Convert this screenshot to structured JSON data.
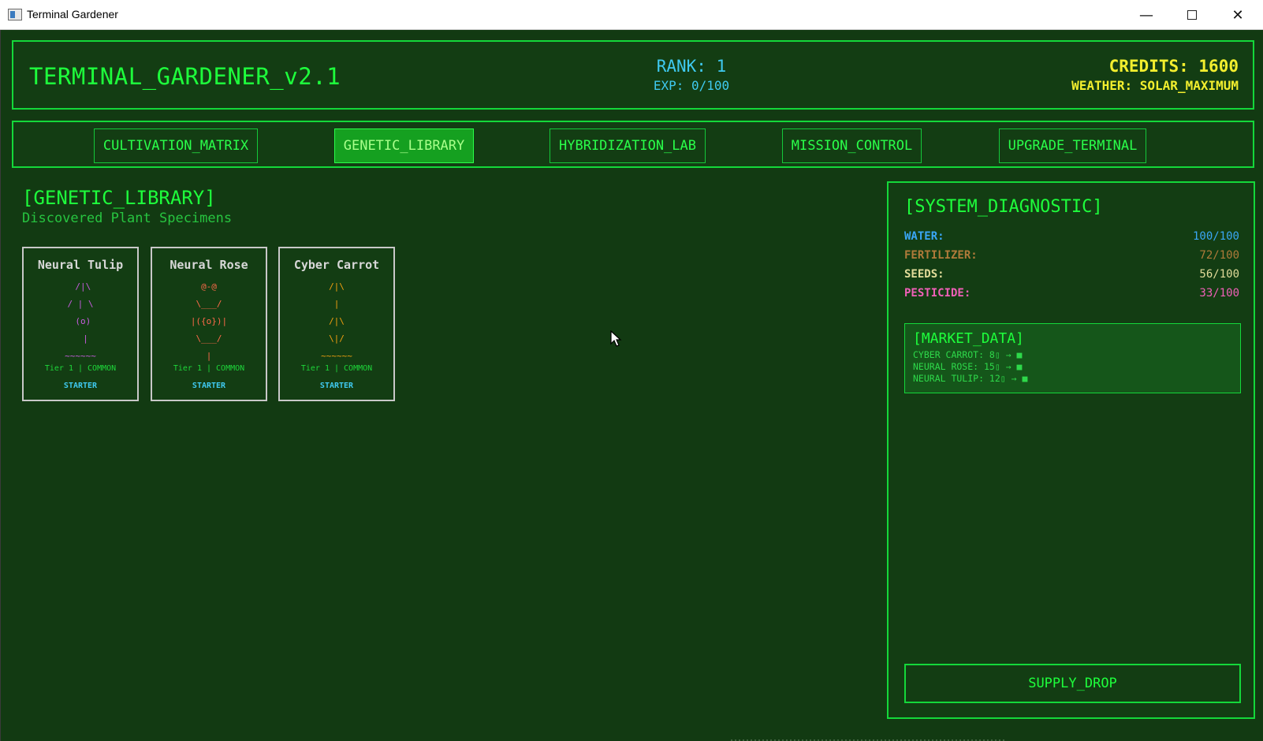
{
  "window": {
    "title": "Terminal Gardener"
  },
  "header": {
    "app_name": "TERMINAL_GARDENER_v2.1",
    "rank": "RANK: 1",
    "exp": "EXP: 0/100",
    "credits": "CREDITS: 1600",
    "weather": "WEATHER: SOLAR_MAXIMUM"
  },
  "nav": {
    "tabs": [
      {
        "label": "CULTIVATION_MATRIX",
        "active": false
      },
      {
        "label": "GENETIC_LIBRARY",
        "active": true
      },
      {
        "label": "HYBRIDIZATION_LAB",
        "active": false
      },
      {
        "label": "MISSION_CONTROL",
        "active": false
      },
      {
        "label": "UPGRADE_TERMINAL",
        "active": false
      }
    ]
  },
  "library": {
    "title": "[GENETIC_LIBRARY]",
    "subtitle": "Discovered Plant Specimens",
    "cards": [
      {
        "name": "Neural Tulip",
        "art": " /|\\\n/ | \\\n (o)\n  |\n~~~~~~",
        "art_color": "#c85ce0",
        "tier": "Tier 1 | COMMON",
        "tag": "STARTER"
      },
      {
        "name": "Neural Rose",
        "art": "@-@\n\\___/\n|({o})|\n\\___/\n|",
        "art_color": "#ff6a4a",
        "tier": "Tier 1 | COMMON",
        "tag": "STARTER"
      },
      {
        "name": "Cyber Carrot",
        "art": "/|\\\n|\n/|\\\n\\|/\n~~~~~~",
        "art_color": "#f2a010",
        "tier": "Tier 1 | COMMON",
        "tag": "STARTER"
      }
    ]
  },
  "diagnostic": {
    "title": "[SYSTEM_DIAGNOSTIC]",
    "stats": [
      {
        "label": "WATER:",
        "value": "100/100",
        "color": "#3aa6f5"
      },
      {
        "label": "FERTILIZER:",
        "value": "72/100",
        "color": "#b07a3a"
      },
      {
        "label": "SEEDS:",
        "value": "56/100",
        "color": "#e2dc9a"
      },
      {
        "label": "PESTICIDE:",
        "value": "33/100",
        "color": "#f060b8"
      }
    ],
    "market": {
      "title": "[MARKET_DATA]",
      "lines": [
        "CYBER CARROT: 8▯ → ■",
        "NEURAL ROSE: 15▯ → ■",
        "NEURAL TULIP: 12▯ → ■"
      ]
    },
    "supply_label": "SUPPLY_DROP"
  }
}
